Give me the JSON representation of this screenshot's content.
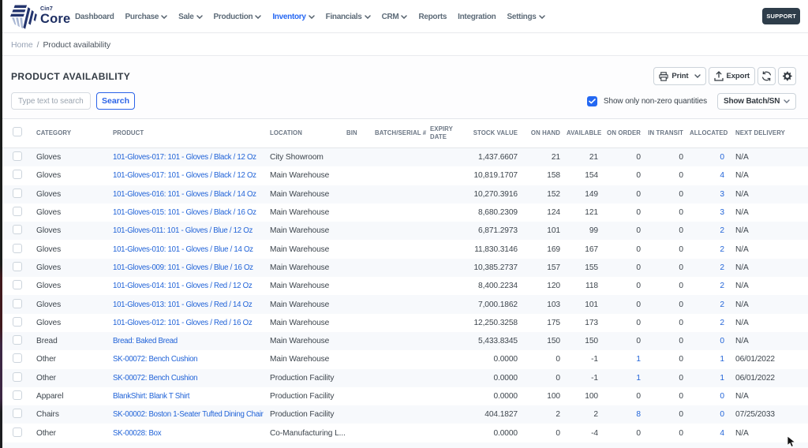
{
  "brand": {
    "name_small": "Cin7",
    "name_big": "Core"
  },
  "nav": {
    "items": [
      {
        "label": "Dashboard",
        "dropdown": false,
        "active": false
      },
      {
        "label": "Purchase",
        "dropdown": true,
        "active": false
      },
      {
        "label": "Sale",
        "dropdown": true,
        "active": false
      },
      {
        "label": "Production",
        "dropdown": true,
        "active": false
      },
      {
        "label": "Inventory",
        "dropdown": true,
        "active": true
      },
      {
        "label": "Financials",
        "dropdown": true,
        "active": false
      },
      {
        "label": "CRM",
        "dropdown": true,
        "active": false
      },
      {
        "label": "Reports",
        "dropdown": false,
        "active": false
      },
      {
        "label": "Integration",
        "dropdown": false,
        "active": false
      },
      {
        "label": "Settings",
        "dropdown": true,
        "active": false
      }
    ],
    "support_label": "SUPPORT"
  },
  "breadcrumb": {
    "home": "Home",
    "separator": "/",
    "current": "Product availability"
  },
  "page": {
    "title": "PRODUCT AVAILABILITY"
  },
  "toolbar": {
    "print_label": "Print",
    "export_label": "Export"
  },
  "search": {
    "placeholder": "Type text to search",
    "button_label": "Search"
  },
  "filters": {
    "checkbox_label": "Show only non-zero quantities",
    "checkbox_checked": true,
    "batch_select_value": "Show Batch/SN"
  },
  "colors": {
    "accent_blue": "#2264d8",
    "checkbox_blue": "#2468f2",
    "support_dark": "#2e3d4a",
    "active_nav_blue": "#2667f2",
    "row_alt": "#f7f9fc"
  },
  "table": {
    "columns": [
      {
        "key": "cb",
        "label": "",
        "type": "checkbox"
      },
      {
        "key": "category",
        "label": "CATEGORY",
        "align": "left"
      },
      {
        "key": "product",
        "label": "PRODUCT",
        "align": "left",
        "link": "always"
      },
      {
        "key": "location",
        "label": "LOCATION",
        "align": "left"
      },
      {
        "key": "bin",
        "label": "BIN",
        "align": "left"
      },
      {
        "key": "batch",
        "label": "BATCH/SERIAL #",
        "align": "left"
      },
      {
        "key": "expiry",
        "label": "EXPIRY DATE",
        "align": "left"
      },
      {
        "key": "stock_value",
        "label": "STOCK VALUE",
        "align": "right"
      },
      {
        "key": "on_hand",
        "label": "ON HAND",
        "align": "right"
      },
      {
        "key": "available",
        "label": "AVAILABLE",
        "align": "right"
      },
      {
        "key": "on_order",
        "label": "ON ORDER",
        "align": "right",
        "link": "nonzero"
      },
      {
        "key": "in_transit",
        "label": "IN TRANSIT",
        "align": "right"
      },
      {
        "key": "allocated",
        "label": "ALLOCATED",
        "align": "right",
        "link": "always"
      },
      {
        "key": "next_delivery",
        "label": "NEXT DELIVERY",
        "align": "left",
        "last": true
      }
    ],
    "rows": [
      {
        "category": "Gloves",
        "product": "101-Gloves-017: 101 - Gloves / Black / 12 Oz",
        "location": "City Showroom",
        "bin": "",
        "batch": "",
        "expiry": "",
        "stock_value": "1,437.6607",
        "on_hand": "21",
        "available": "21",
        "on_order": "0",
        "in_transit": "0",
        "allocated": "0",
        "next_delivery": "N/A"
      },
      {
        "category": "Gloves",
        "product": "101-Gloves-017: 101 - Gloves / Black / 12 Oz",
        "location": "Main Warehouse",
        "bin": "",
        "batch": "",
        "expiry": "",
        "stock_value": "10,819.1707",
        "on_hand": "158",
        "available": "154",
        "on_order": "0",
        "in_transit": "0",
        "allocated": "4",
        "next_delivery": "N/A"
      },
      {
        "category": "Gloves",
        "product": "101-Gloves-016: 101 - Gloves / Black / 14 Oz",
        "location": "Main Warehouse",
        "bin": "",
        "batch": "",
        "expiry": "",
        "stock_value": "10,270.3916",
        "on_hand": "152",
        "available": "149",
        "on_order": "0",
        "in_transit": "0",
        "allocated": "3",
        "next_delivery": "N/A"
      },
      {
        "category": "Gloves",
        "product": "101-Gloves-015: 101 - Gloves / Black / 16 Oz",
        "location": "Main Warehouse",
        "bin": "",
        "batch": "",
        "expiry": "",
        "stock_value": "8,680.2309",
        "on_hand": "124",
        "available": "121",
        "on_order": "0",
        "in_transit": "0",
        "allocated": "3",
        "next_delivery": "N/A"
      },
      {
        "category": "Gloves",
        "product": "101-Gloves-011: 101 - Gloves / Blue / 12 Oz",
        "location": "Main Warehouse",
        "bin": "",
        "batch": "",
        "expiry": "",
        "stock_value": "6,871.2973",
        "on_hand": "101",
        "available": "99",
        "on_order": "0",
        "in_transit": "0",
        "allocated": "2",
        "next_delivery": "N/A"
      },
      {
        "category": "Gloves",
        "product": "101-Gloves-010: 101 - Gloves / Blue / 14 Oz",
        "location": "Main Warehouse",
        "bin": "",
        "batch": "",
        "expiry": "",
        "stock_value": "11,830.3146",
        "on_hand": "169",
        "available": "167",
        "on_order": "0",
        "in_transit": "0",
        "allocated": "2",
        "next_delivery": "N/A"
      },
      {
        "category": "Gloves",
        "product": "101-Gloves-009: 101 - Gloves / Blue / 16 Oz",
        "location": "Main Warehouse",
        "bin": "",
        "batch": "",
        "expiry": "",
        "stock_value": "10,385.2737",
        "on_hand": "157",
        "available": "155",
        "on_order": "0",
        "in_transit": "0",
        "allocated": "2",
        "next_delivery": "N/A"
      },
      {
        "category": "Gloves",
        "product": "101-Gloves-014: 101 - Gloves / Red / 12 Oz",
        "location": "Main Warehouse",
        "bin": "",
        "batch": "",
        "expiry": "",
        "stock_value": "8,400.2234",
        "on_hand": "120",
        "available": "118",
        "on_order": "0",
        "in_transit": "0",
        "allocated": "2",
        "next_delivery": "N/A"
      },
      {
        "category": "Gloves",
        "product": "101-Gloves-013: 101 - Gloves / Red / 14 Oz",
        "location": "Main Warehouse",
        "bin": "",
        "batch": "",
        "expiry": "",
        "stock_value": "7,000.1862",
        "on_hand": "103",
        "available": "101",
        "on_order": "0",
        "in_transit": "0",
        "allocated": "2",
        "next_delivery": "N/A"
      },
      {
        "category": "Gloves",
        "product": "101-Gloves-012: 101 - Gloves / Red / 16 Oz",
        "location": "Main Warehouse",
        "bin": "",
        "batch": "",
        "expiry": "",
        "stock_value": "12,250.3258",
        "on_hand": "175",
        "available": "173",
        "on_order": "0",
        "in_transit": "0",
        "allocated": "2",
        "next_delivery": "N/A"
      },
      {
        "category": "Bread",
        "product": "Bread: Baked Bread",
        "location": "Main Warehouse",
        "bin": "",
        "batch": "",
        "expiry": "",
        "stock_value": "5,433.8345",
        "on_hand": "150",
        "available": "150",
        "on_order": "0",
        "in_transit": "0",
        "allocated": "0",
        "next_delivery": "N/A"
      },
      {
        "category": "Other",
        "product": "SK-00072: Bench Cushion",
        "location": "Main Warehouse",
        "bin": "",
        "batch": "",
        "expiry": "",
        "stock_value": "0.0000",
        "on_hand": "0",
        "available": "-1",
        "on_order": "1",
        "in_transit": "0",
        "allocated": "1",
        "next_delivery": "06/01/2022"
      },
      {
        "category": "Other",
        "product": "SK-00072: Bench Cushion",
        "location": "Production Facility",
        "bin": "",
        "batch": "",
        "expiry": "",
        "stock_value": "0.0000",
        "on_hand": "0",
        "available": "-1",
        "on_order": "1",
        "in_transit": "0",
        "allocated": "1",
        "next_delivery": "06/01/2022"
      },
      {
        "category": "Apparel",
        "product": "BlankShirt: Blank T Shirt",
        "location": "Production Facility",
        "bin": "",
        "batch": "",
        "expiry": "",
        "stock_value": "0.0000",
        "on_hand": "100",
        "available": "100",
        "on_order": "0",
        "in_transit": "0",
        "allocated": "0",
        "next_delivery": "N/A"
      },
      {
        "category": "Chairs",
        "product": "SK-00002: Boston 1-Seater Tufted Dining Chair",
        "location": "Production Facility",
        "bin": "",
        "batch": "",
        "expiry": "",
        "stock_value": "404.1827",
        "on_hand": "2",
        "available": "2",
        "on_order": "8",
        "in_transit": "0",
        "allocated": "0",
        "next_delivery": "07/25/2033"
      },
      {
        "category": "Other",
        "product": "SK-00028: Box",
        "location": "Co-Manufacturing L...",
        "bin": "",
        "batch": "",
        "expiry": "",
        "stock_value": "0.0000",
        "on_hand": "0",
        "available": "-4",
        "on_order": "0",
        "in_transit": "0",
        "allocated": "4",
        "next_delivery": "N/A"
      }
    ]
  }
}
